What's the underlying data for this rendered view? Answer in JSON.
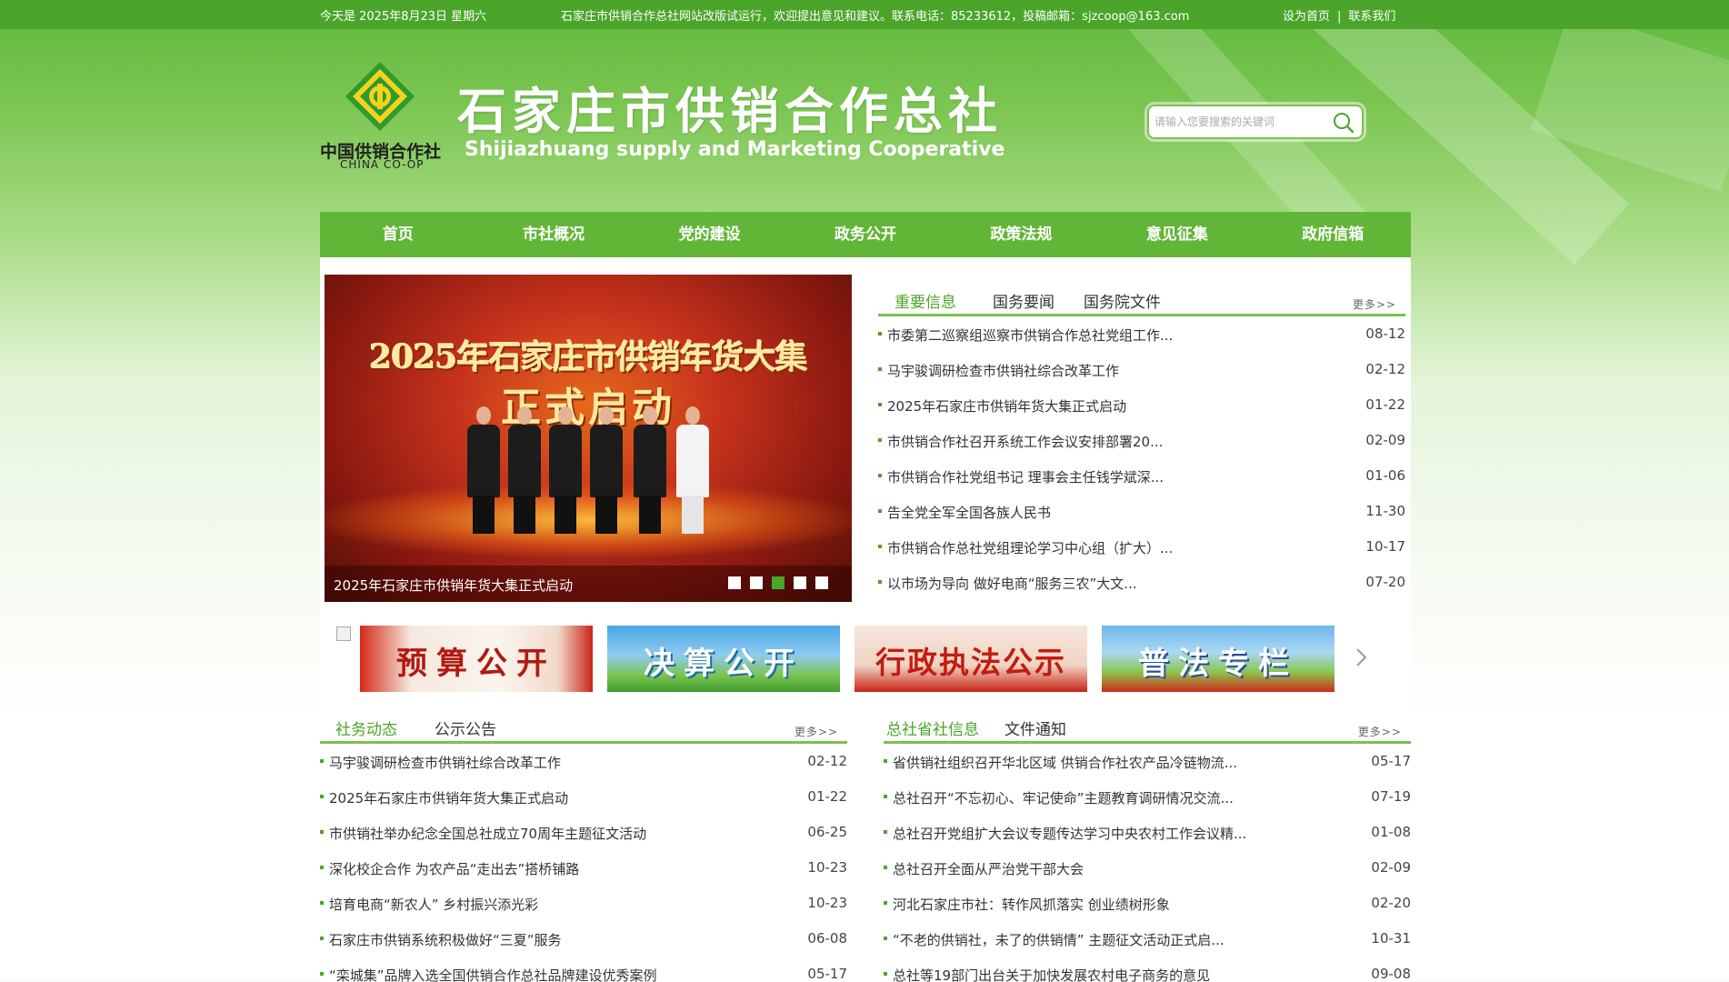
{
  "topbar": {
    "date": "今天是  2025年8月23日 星期六",
    "notice": "石家庄市供销合作总社网站改版试运行，欢迎提出意见和建议。联系电话：85233612，投稿邮箱：sjzcoop@163.com",
    "set_home": "设为首页",
    "separator": "|",
    "contact": "联系我们"
  },
  "header": {
    "logo_cn": "中国供销合作社",
    "logo_en": "CHINA CO-OP",
    "title": "石家庄市供销合作总社",
    "subtitle": "Shijiazhuang supply and Marketing Cooperative",
    "search_placeholder": "请输入您要搜索的关键词",
    "search_icon": "search-icon"
  },
  "colors": {
    "brand_green": "#4aa52a",
    "nav_green": "#62b637",
    "tab_underline": "#7cc04e"
  },
  "nav": [
    "首页",
    "市社概况",
    "党的建设",
    "政务公开",
    "政策法规",
    "意见征集",
    "政府信箱"
  ],
  "slider": {
    "headline1": "2025年石家庄市供销年货大集",
    "headline2": "正式启动",
    "caption": "2025年石家庄市供销年货大集正式启动",
    "dot_count": 5,
    "active_dot": 3
  },
  "news_top": {
    "tabs": [
      "重要信息",
      "国务要闻",
      "国务院文件"
    ],
    "more": "更多>>",
    "items": [
      {
        "title": "市委第二巡察组巡察市供销合作总社党组工作...",
        "date": "08-12"
      },
      {
        "title": "马宇骏调研检查市供销社综合改革工作",
        "date": "02-12"
      },
      {
        "title": "2025年石家庄市供销年货大集正式启动",
        "date": "01-22"
      },
      {
        "title": "市供销合作社召开系统工作会议安排部署20...",
        "date": "02-09"
      },
      {
        "title": "市供销合作社党组书记 理事会主任钱学斌深...",
        "date": "01-06"
      },
      {
        "title": "告全党全军全国各族人民书",
        "date": "11-30"
      },
      {
        "title": "市供销合作总社党组理论学习中心组（扩大）...",
        "date": "10-17"
      },
      {
        "title": "以市场为导向 做好电商“服务三农”大文...",
        "date": "07-20"
      }
    ]
  },
  "banners": [
    "预算公开",
    "决算公开",
    "行政执法公示",
    "普法专栏"
  ],
  "news_left": {
    "tabs": [
      "社务动态",
      "公示公告"
    ],
    "more": "更多>>",
    "items": [
      {
        "title": "马宇骏调研检查市供销社综合改革工作",
        "date": "02-12"
      },
      {
        "title": "2025年石家庄市供销年货大集正式启动",
        "date": "01-22"
      },
      {
        "title": "市供销社举办纪念全国总社成立70周年主题征文活动",
        "date": "06-25"
      },
      {
        "title": "深化校企合作 为农产品“走出去”搭桥铺路",
        "date": "10-23"
      },
      {
        "title": "培育电商“新农人” 乡村振兴添光彩",
        "date": "10-23"
      },
      {
        "title": "石家庄市供销系统积极做好“三夏”服务",
        "date": "06-08"
      },
      {
        "title": "“栾城集”品牌入选全国供销合作总社品牌建设优秀案例",
        "date": "05-17"
      }
    ]
  },
  "news_right": {
    "tabs": [
      "总社省社信息",
      "文件通知"
    ],
    "more": "更多>>",
    "items": [
      {
        "title": "省供销社组织召开华北区域 供销合作社农产品冷链物流...",
        "date": "05-17"
      },
      {
        "title": "总社召开“不忘初心、牢记使命”主题教育调研情况交流...",
        "date": "07-19"
      },
      {
        "title": "总社召开党组扩大会议专题传达学习中央农村工作会议精...",
        "date": "01-08"
      },
      {
        "title": "总社召开全面从严治党干部大会",
        "date": "02-09"
      },
      {
        "title": "河北石家庄市社：转作风抓落实 创业绩树形象",
        "date": "02-20"
      },
      {
        "title": "“不老的供销社，未了的供销情” 主题征文活动正式启...",
        "date": "10-31"
      },
      {
        "title": "总社等19部门出台关于加快发展农村电子商务的意见",
        "date": "09-08"
      }
    ]
  }
}
